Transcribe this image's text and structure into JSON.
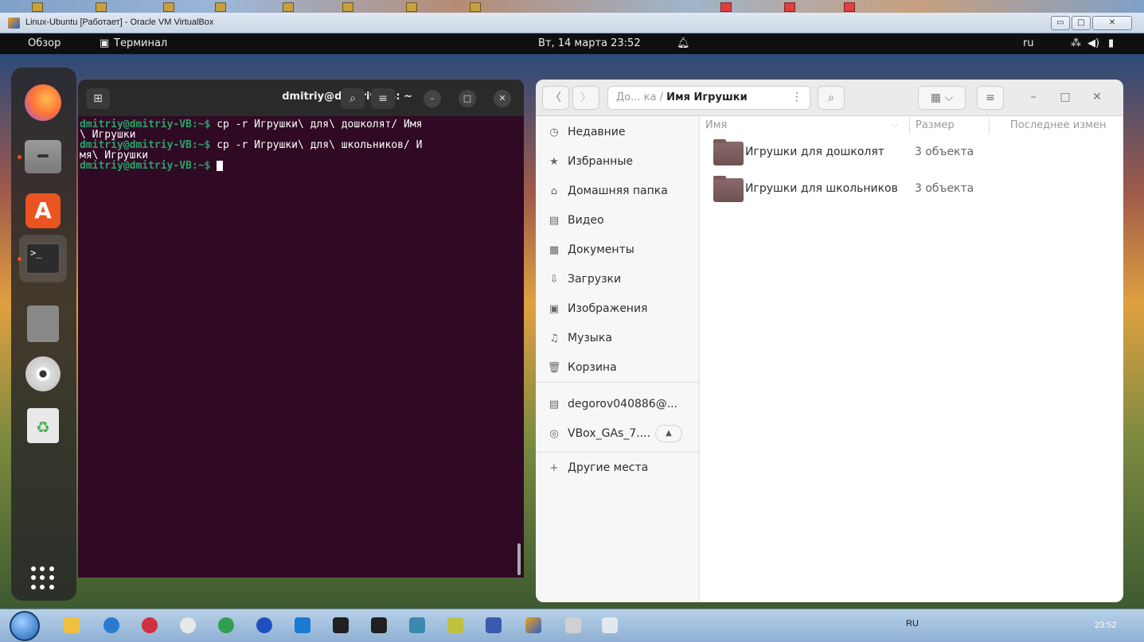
{
  "vbox": {
    "title": "Linux-Ubuntu [Работает] - Oracle VM VirtualBox",
    "controls": {
      "minimize": "▭",
      "maximize": "□",
      "close": "✕"
    }
  },
  "ubuntu_bar": {
    "activities": "Обзор",
    "app_menu": "Терминал",
    "datetime": "Вт, 14 марта  23:52",
    "keyboard": "ru"
  },
  "dock": {
    "items": [
      "firefox",
      "files",
      "app-center",
      "terminal",
      "disks",
      "cd-drive",
      "trash",
      "show-apps"
    ]
  },
  "terminal": {
    "title": "dmitriy@dmitriy-VB: ~",
    "lines": [
      {
        "prompt": "dmitriy@dmitriy-VB:~$",
        "cmd": " cp -r Игрушки\\ для\\ дошколят/ Имя\n\\ Игрушки"
      },
      {
        "prompt": "dmitriy@dmitriy-VB:~$",
        "cmd": " cp -r Игрушки\\ для\\ школьников/ И\nмя\\ Игрушки"
      },
      {
        "prompt": "dmitriy@dmitriy-VB:~$",
        "cmd": " "
      }
    ]
  },
  "files": {
    "path_prefix": "До... ка  /",
    "path_current": "Имя Игрушки",
    "sidebar": [
      {
        "icon": "clock-icon",
        "glyph": "◷",
        "label": "Недавние"
      },
      {
        "icon": "star-icon",
        "glyph": "★",
        "label": "Избранные"
      },
      {
        "icon": "home-icon",
        "glyph": "⌂",
        "label": "Домашняя папка"
      },
      {
        "icon": "video-icon",
        "glyph": "▤",
        "label": "Видео"
      },
      {
        "icon": "document-icon",
        "glyph": "▦",
        "label": "Документы"
      },
      {
        "icon": "download-icon",
        "glyph": "⇩",
        "label": "Загрузки"
      },
      {
        "icon": "image-icon",
        "glyph": "▣",
        "label": "Изображения"
      },
      {
        "icon": "music-icon",
        "glyph": "♫",
        "label": "Музыка"
      },
      {
        "icon": "trash-icon",
        "glyph": "🗑",
        "label": "Корзина"
      }
    ],
    "devices": [
      {
        "icon": "drive-icon",
        "glyph": "▤",
        "label": "degorov040886@..."
      },
      {
        "icon": "disc-icon",
        "glyph": "◎",
        "label": "VBox_GAs_7...."
      }
    ],
    "other_places": "Другие места",
    "columns": {
      "name": "Имя",
      "size": "Размер",
      "modified": "Последнее измен"
    },
    "rows": [
      {
        "name": "Игрушки для дошколят",
        "size": "3 объекта"
      },
      {
        "name": "Игрушки для школьников",
        "size": "3 объекта"
      }
    ]
  },
  "taskbar": {
    "lang": "RU",
    "time": "23:52"
  }
}
